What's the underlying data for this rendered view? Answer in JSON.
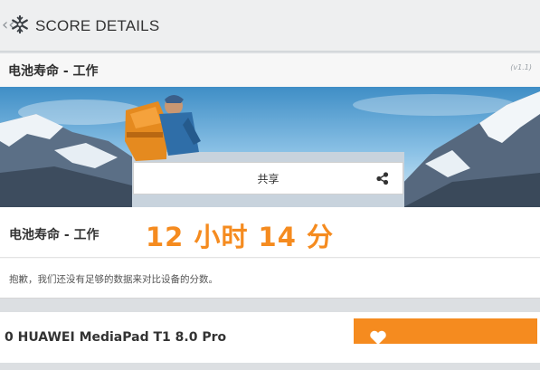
{
  "header": {
    "back_glyph": "‹‹",
    "title": "SCORE DETAILS",
    "icon": "snowflake-icon"
  },
  "card": {
    "title": "电池寿命 - 工作",
    "version": "(v1.1)",
    "share_label": "共享",
    "share_icon": "share-icon",
    "result_label": "电池寿命 - 工作",
    "result_value": "12 小时 14 分",
    "note": "抱歉，我们还没有足够的数据来对比设备的分数。"
  },
  "device": {
    "name": "0 HUAWEI MediaPad T1 8.0 Pro",
    "fav_icon": "heart-icon"
  },
  "colors": {
    "accent": "#f58b1f",
    "background": "#dcdfe2"
  }
}
